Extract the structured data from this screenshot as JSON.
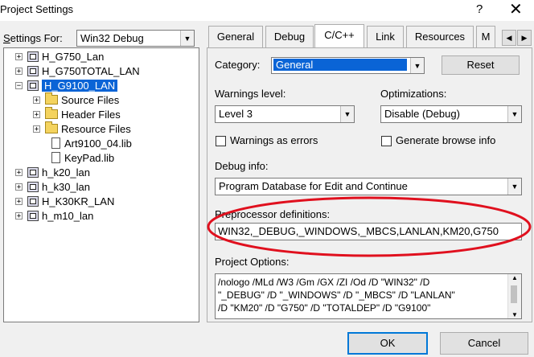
{
  "window": {
    "title": "Project Settings",
    "help": "?",
    "close": "✕"
  },
  "settings_for": {
    "label": "Settings For:",
    "value": "Win32 Debug"
  },
  "tree": [
    {
      "label": "H_G750_Lan",
      "expander": "+"
    },
    {
      "label": "H_G750TOTAL_LAN",
      "expander": "+"
    },
    {
      "label": "H_G9100_LAN",
      "expander": "−"
    },
    {
      "label": "Source Files",
      "expander": "+"
    },
    {
      "label": "Header Files",
      "expander": "+"
    },
    {
      "label": "Resource Files",
      "expander": "+"
    },
    {
      "label": "Art9100_04.lib"
    },
    {
      "label": "KeyPad.lib"
    },
    {
      "label": "h_k20_lan",
      "expander": "+"
    },
    {
      "label": "h_k30_lan",
      "expander": "+"
    },
    {
      "label": "H_K30KR_LAN",
      "expander": "+"
    },
    {
      "label": "h_m10_lan",
      "expander": "+"
    }
  ],
  "tabs": [
    {
      "label": "General"
    },
    {
      "label": "Debug"
    },
    {
      "label": "C/C++"
    },
    {
      "label": "Link"
    },
    {
      "label": "Resources"
    },
    {
      "label": "M"
    }
  ],
  "tab_scroll": {
    "left": "◀",
    "right": "▶"
  },
  "category": {
    "label": "Category:",
    "value": "General"
  },
  "reset_label": "Reset",
  "warning_level": {
    "label": "Warnings level:",
    "value": "Level 3"
  },
  "optimizations": {
    "label": "Optimizations:",
    "value": "Disable (Debug)"
  },
  "warnings_as_errors": "Warnings as errors",
  "generate_browse_info": "Generate browse info",
  "debug_info": {
    "label": "Debug info:",
    "value": "Program Database for Edit and Continue"
  },
  "preprocessor": {
    "label": "Preprocessor definitions:",
    "value": "WIN32,_DEBUG,_WINDOWS,_MBCS,LANLAN,KM20,G750"
  },
  "project_options": {
    "label": "Project Options:",
    "lines": [
      "/nologo /MLd /W3 /Gm /GX /ZI /Od /D \"WIN32\" /D",
      "\"_DEBUG\" /D \"_WINDOWS\" /D \"_MBCS\" /D \"LANLAN\"",
      "/D \"KM20\" /D \"G750\" /D \"TOTALDEP\" /D \"G9100\""
    ]
  },
  "ok_label": "OK",
  "cancel_label": "Cancel",
  "glyphs": {
    "dropdown": "▼",
    "scroll_up": "▲",
    "scroll_down": "▼"
  },
  "colors": {
    "selection": "#0a64d6",
    "annotation": "#e0101e"
  }
}
